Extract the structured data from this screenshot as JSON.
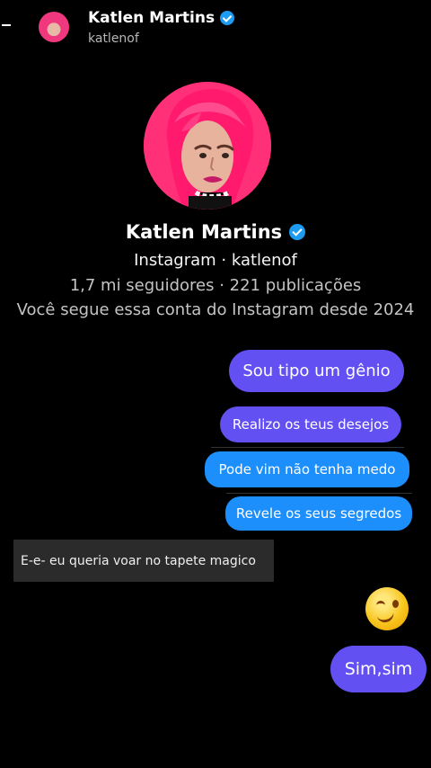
{
  "header": {
    "name": "Katlen Martins",
    "handle": "katlenof",
    "avatar_icon": "profile-avatar-icon",
    "verified_icon": "verified-badge-icon"
  },
  "profile": {
    "name": "Katlen Martins",
    "source": "Instagram · katlenof",
    "stats": "1,7 mi seguidores · 221 publicações",
    "follow_since": "Você segue essa conta do Instagram desde 2024"
  },
  "messages": [
    {
      "text": "Sou tipo um gênio",
      "color": "#6350F2"
    },
    {
      "text": "Realizo os teus desejos",
      "color": "#6350F2"
    },
    {
      "text": "Pode vim não tenha medo",
      "color": "#1D8FFD"
    },
    {
      "text": "Revele os seus segredos",
      "color": "#1D8FFD"
    },
    {
      "text": "E-e- eu queria voar no tapete magico",
      "color": "#2B2B2B"
    },
    {
      "text": "😉",
      "icon": "winking-face-icon"
    },
    {
      "text": "Sim,sim",
      "color": "#5E4CF0"
    }
  ],
  "colors": {
    "background": "#000000",
    "verified": "#1D9BF0",
    "primary_text": "#FFFFFF",
    "secondary_text": "#C4C4C4"
  }
}
